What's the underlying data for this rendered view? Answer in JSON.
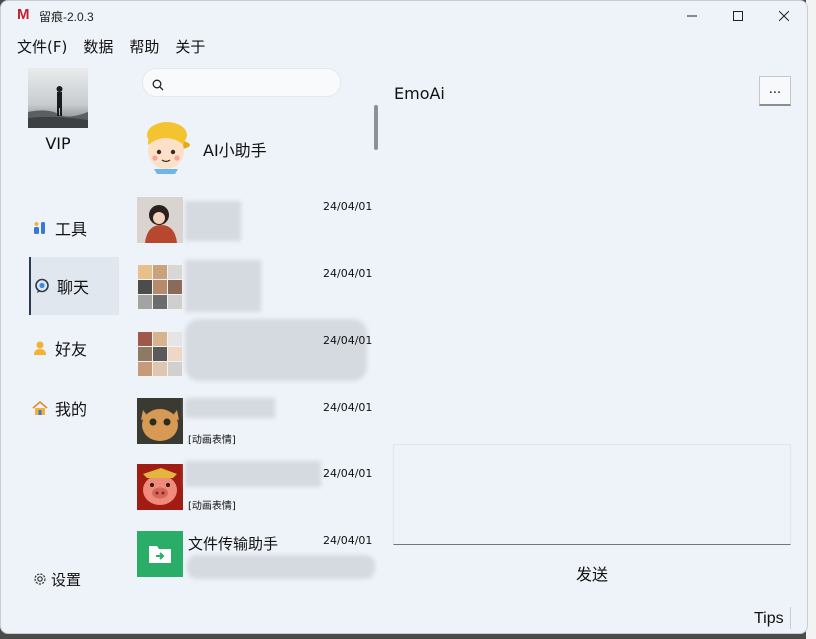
{
  "window": {
    "title": "留痕-2.0.3",
    "logo_letter": "M"
  },
  "menu": [
    "文件(F)",
    "数据",
    "帮助",
    "关于"
  ],
  "user": {
    "label": "VIP"
  },
  "nav": [
    {
      "label": "工具",
      "icon": "tools-icon"
    },
    {
      "label": "聊天",
      "icon": "chat-icon",
      "active": true
    },
    {
      "label": "好友",
      "icon": "friend-icon"
    },
    {
      "label": "我的",
      "icon": "home-icon"
    }
  ],
  "settings": {
    "label": "设置"
  },
  "search": {
    "placeholder": ""
  },
  "ai_assistant": {
    "name": "AI小助手"
  },
  "chats": [
    {
      "time": "24/04/01",
      "preview": ""
    },
    {
      "time": "24/04/01",
      "preview": ""
    },
    {
      "time": "24/04/01",
      "preview": ""
    },
    {
      "time": "24/04/01",
      "preview": "[动画表情]"
    },
    {
      "time": "24/04/01",
      "preview": "[动画表情]"
    },
    {
      "time": "24/04/01",
      "name": "文件传输助手",
      "preview": ""
    }
  ],
  "conversation": {
    "title": "EmoAi",
    "more_label": "...",
    "send_label": "发送",
    "tips_label": "Tips"
  },
  "colors": {
    "window_bg": "#eef3f9",
    "logo_red": "#c8202a",
    "file_helper_green": "#2aae67"
  }
}
